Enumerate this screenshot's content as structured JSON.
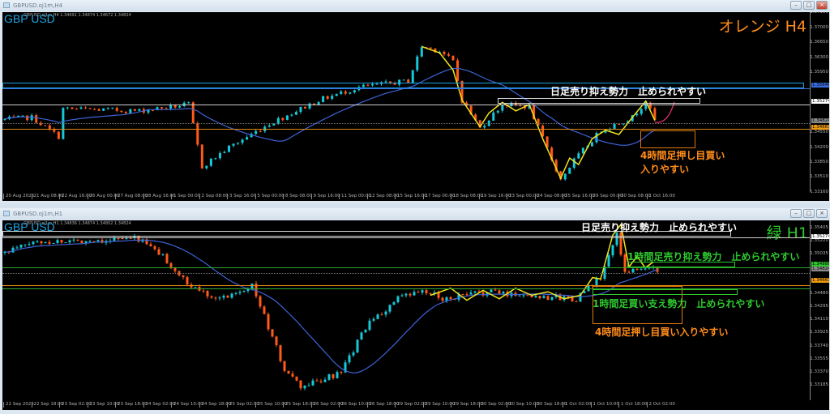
{
  "colors": {
    "bull": "#16c8d8",
    "bear": "#ff5a1a",
    "ma": "#3d63d6",
    "zigzag": "#f2e41c",
    "orange": "#ff8c1a",
    "green": "#2ec82e",
    "blue": "#1aa0e0",
    "white": "#e6e6e6"
  },
  "top": {
    "title": "GBPUSD.oj1m,H4",
    "symbol": "GBP USD",
    "ohlc": "GBPUSD.oj1m,H4  1.34691 1.34874 1.34672 1.34824",
    "timeframe_label": "オレンジ H4",
    "annotations": {
      "resistance": "日足売り抑え勢力　止められやすい",
      "buy_line1": "4時間足押し目買い",
      "buy_line2": "入りやすい"
    },
    "price_labels": [
      "1.37350",
      "1.37000",
      "1.36650",
      "1.36300",
      "1.35950",
      "1.34550",
      "1.34200",
      "1.33850",
      "1.33510",
      "1.33160"
    ],
    "price_tags": [
      {
        "price": "1.35646",
        "color": "#3a6ee0"
      },
      {
        "price": "1.35274",
        "color": "#ffffff"
      },
      {
        "price": "1.34824",
        "color": "#8a8a8a"
      },
      {
        "price": "1.34661",
        "color": "#f09a10"
      }
    ],
    "time_labels": [
      "20 Aug 2025",
      "21 Aug 08:00",
      "22 Aug 16:00",
      "26 Aug 00:00",
      "27 Aug 08:00",
      "28 Aug 16:00",
      "1 Sep 00:00",
      "2 Sep 08:00",
      "3 Sep 16:00",
      "5 Sep 00:00",
      "8 Sep 08:00",
      "9 Sep 16:00",
      "11 Sep 00:00",
      "12 Sep 08:00",
      "15 Sep 16:00",
      "17 Sep 00:00",
      "18 Sep 08:00",
      "19 Sep 16:00",
      "23 Sep 00:00",
      "24 Sep 08:00",
      "25 Sep 16:00",
      "29 Sep 00:00",
      "30 Sep 08:00",
      "1 Oct 16:00"
    ],
    "candle_count": 146,
    "waypoints": [
      [
        0,
        1.3485
      ],
      [
        6,
        1.349
      ],
      [
        12,
        1.3445
      ],
      [
        13,
        1.351
      ],
      [
        30,
        1.3505
      ],
      [
        41,
        1.352
      ],
      [
        44,
        1.3375
      ],
      [
        50,
        1.342
      ],
      [
        59,
        1.3475
      ],
      [
        70,
        1.353
      ],
      [
        79,
        1.356
      ],
      [
        90,
        1.3575
      ],
      [
        93,
        1.3655
      ],
      [
        97,
        1.3645
      ],
      [
        100,
        1.362
      ],
      [
        102,
        1.353
      ],
      [
        106,
        1.3465
      ],
      [
        111,
        1.352
      ],
      [
        117,
        1.3515
      ],
      [
        120,
        1.344
      ],
      [
        124,
        1.3345
      ],
      [
        127,
        1.339
      ],
      [
        133,
        1.346
      ],
      [
        140,
        1.349
      ],
      [
        143,
        1.3528
      ],
      [
        145,
        1.3483
      ]
    ],
    "zigzag": [
      [
        93,
        1.3655
      ],
      [
        97,
        1.364
      ],
      [
        100,
        1.36
      ],
      [
        102,
        1.353
      ],
      [
        106,
        1.3468
      ],
      [
        108,
        1.35
      ],
      [
        111,
        1.3525
      ],
      [
        114,
        1.3505
      ],
      [
        117,
        1.352
      ],
      [
        120,
        1.344
      ],
      [
        124,
        1.3348
      ],
      [
        126,
        1.3395
      ],
      [
        128,
        1.338
      ],
      [
        131,
        1.344
      ],
      [
        134,
        1.346
      ],
      [
        137,
        1.345
      ],
      [
        140,
        1.349
      ],
      [
        143,
        1.3528
      ],
      [
        145,
        1.3483
      ]
    ]
  },
  "bottom": {
    "title": "GBPUSD.oj1m,H1",
    "symbol": "GBP USD",
    "ohlc": "GBPUSD.oj1m,H1  1.34836 1.34874 1.34802 1.34824",
    "timeframe_label": "緑 H1",
    "annotations": {
      "daily_resistance": "日足売り抑え勢力　止められやすい",
      "h1_resistance": "1時間足売り抑え勢力　止められやすい",
      "h1_support": "1時間足買い支え勢力　止められやすい",
      "h4_buy": "4時間足押し目買い入りやすい"
    },
    "price_labels": [
      "1.35405",
      "1.35220",
      "1.35035",
      "1.34480",
      "1.34295",
      "1.34110",
      "1.33925",
      "1.33740",
      "1.33555",
      "1.33370",
      "1.33185"
    ],
    "price_tags": [
      {
        "price": "1.35274",
        "color": "#ffffff"
      },
      {
        "price": "1.34888",
        "color": "#2ec82e"
      },
      {
        "price": "1.34824",
        "color": "#8a8a8a"
      },
      {
        "price": "1.34661",
        "color": "#f09a10"
      }
    ],
    "time_labels": [
      "22 Sep 2025",
      "22 Sep 18:00",
      "23 Sep 02:00",
      "23 Sep 10:00",
      "23 Sep 18:00",
      "24 Sep 02:00",
      "24 Sep 10:00",
      "24 Sep 18:00",
      "25 Sep 02:00",
      "25 Sep 10:00",
      "25 Sep 18:00",
      "26 Sep 02:00",
      "26 Sep 10:00",
      "26 Sep 18:00",
      "29 Sep 02:00",
      "29 Sep 10:00",
      "29 Sep 18:00",
      "30 Sep 02:00",
      "30 Sep 10:00",
      "30 Sep 18:00",
      "1 Oct 02:00",
      "1 Oct 10:00",
      "1 Oct 18:00",
      "2 Oct 02:00"
    ],
    "candle_count": 162,
    "waypoints": [
      [
        0,
        1.3505
      ],
      [
        7,
        1.352
      ],
      [
        33,
        1.3525
      ],
      [
        39,
        1.35
      ],
      [
        45,
        1.346
      ],
      [
        53,
        1.344
      ],
      [
        61,
        1.346
      ],
      [
        65,
        1.34
      ],
      [
        69,
        1.334
      ],
      [
        73,
        1.3315
      ],
      [
        83,
        1.3335
      ],
      [
        89,
        1.34
      ],
      [
        97,
        1.344
      ],
      [
        103,
        1.345
      ],
      [
        109,
        1.344
      ],
      [
        119,
        1.345
      ],
      [
        129,
        1.3445
      ],
      [
        141,
        1.344
      ],
      [
        147,
        1.347
      ],
      [
        151,
        1.353
      ],
      [
        153,
        1.348
      ],
      [
        159,
        1.3483
      ],
      [
        161,
        1.3482
      ]
    ],
    "zigzag": [
      [
        105,
        1.3445
      ],
      [
        110,
        1.3455
      ],
      [
        114,
        1.3438
      ],
      [
        118,
        1.3452
      ],
      [
        122,
        1.344
      ],
      [
        126,
        1.3455
      ],
      [
        130,
        1.3445
      ],
      [
        134,
        1.345
      ],
      [
        138,
        1.344
      ],
      [
        142,
        1.3445
      ],
      [
        145,
        1.347
      ],
      [
        147,
        1.3468
      ],
      [
        150,
        1.353
      ],
      [
        152,
        1.3545
      ],
      [
        154,
        1.3485
      ],
      [
        156,
        1.35
      ],
      [
        158,
        1.3484
      ],
      [
        160,
        1.3492
      ]
    ]
  }
}
